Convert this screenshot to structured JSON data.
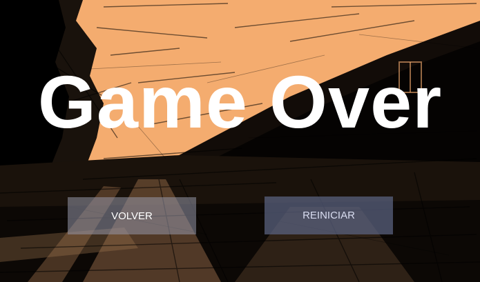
{
  "screen": {
    "title": "Game Over"
  },
  "buttons": {
    "back_label": "VOLVER",
    "restart_label": "REINICIAR"
  },
  "colors": {
    "sky": "#f4ac6f",
    "ink": "#000000",
    "title_text": "#ffffff",
    "back_button_bg": "#9698aa",
    "restart_button_bg": "#5c6482"
  }
}
